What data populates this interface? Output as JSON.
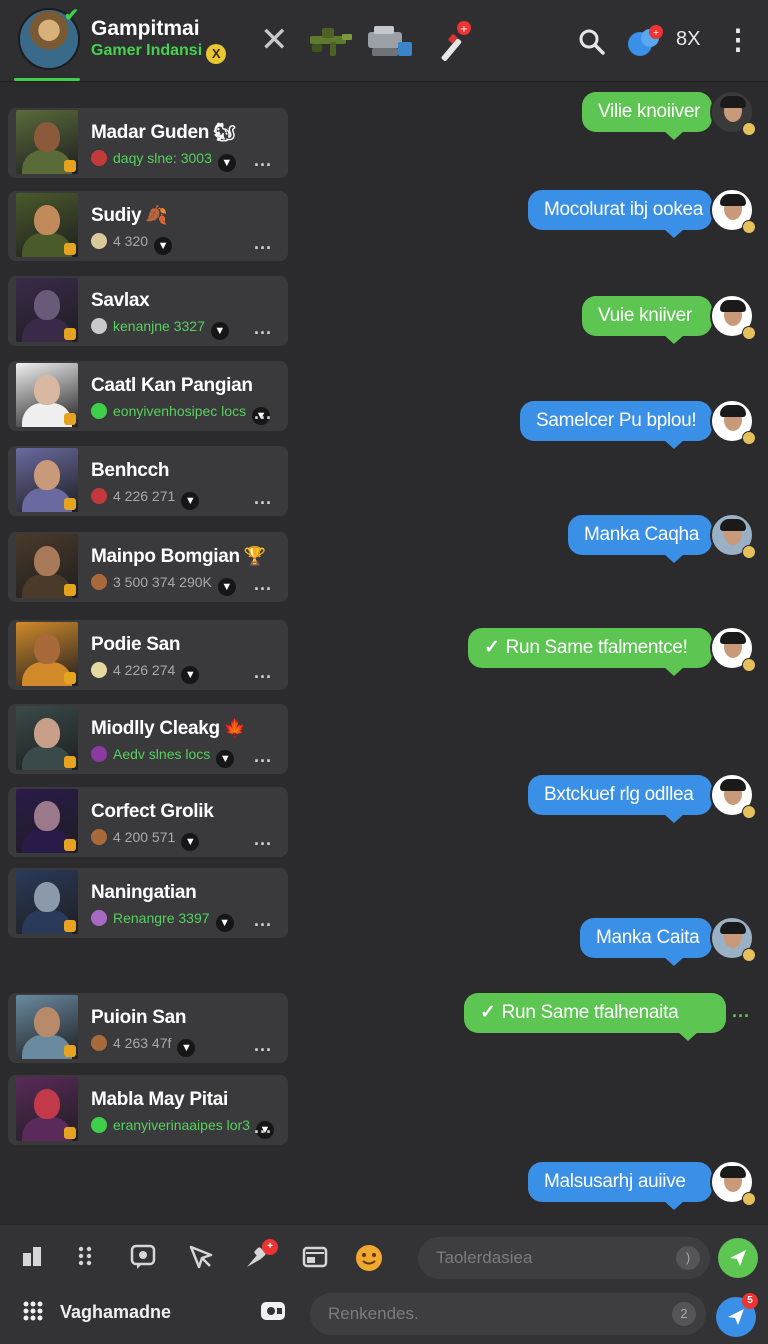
{
  "header": {
    "title": "Gampitmai",
    "subtitle": "Gamer Indansi",
    "subtitle_badge": "X",
    "close_symbol": "✕",
    "count_label": "8X",
    "accent": "#3ecf4a"
  },
  "contacts": [
    {
      "name": "Madar Guden",
      "stats": "daqy slne: 3003",
      "tag": "🐿",
      "stat_color": "green",
      "avatar_bg": "#5a6b3a",
      "face": "#8a5a3a"
    },
    {
      "name": "Sudiy",
      "stats": "4 320",
      "tag": "🍂",
      "stat_color": "gray",
      "avatar_bg": "#4a5a2a",
      "face": "#c28a5a"
    },
    {
      "name": "Savlax",
      "stats": "kenanjne 3327",
      "tag": "",
      "stat_color": "green",
      "avatar_bg": "#3a2a4a",
      "face": "#6a5a7a"
    },
    {
      "name": "Caatl Kan Pangian",
      "stats": "eonyivenhosipec locs",
      "tag": "",
      "stat_color": "green",
      "avatar_bg": "#f0f0f0",
      "face": "#d8b8a0"
    },
    {
      "name": "Benhcch",
      "stats": "4 226   271",
      "tag": "",
      "stat_color": "gray",
      "avatar_bg": "#6a6aa0",
      "face": "#c89a7a"
    },
    {
      "name": "Mainpo Bomgian",
      "stats": "3 500   374   290K",
      "tag": "🏆",
      "stat_color": "gray",
      "avatar_bg": "#4a3a2a",
      "face": "#a87a5a"
    },
    {
      "name": "Podie San",
      "stats": "4 226   274",
      "tag": "",
      "stat_color": "gray",
      "avatar_bg": "#d08a2a",
      "face": "#a86a3a"
    },
    {
      "name": "Miodlly Cleakg",
      "stats": "Aedv slnes locs",
      "tag": "🍁",
      "stat_color": "green",
      "avatar_bg": "#3a4a4a",
      "face": "#c8a08a"
    },
    {
      "name": "Corfect Grolik",
      "stats": "4 200   571",
      "tag": "",
      "stat_color": "gray",
      "avatar_bg": "#2a1a4a",
      "face": "#9a7a8a"
    },
    {
      "name": "Naningatian",
      "stats": "Renangre 3397",
      "tag": "",
      "stat_color": "green",
      "avatar_bg": "#2a3a5a",
      "face": "#8a9aaa"
    },
    {
      "name": "Puioin San",
      "stats": "4 263   47f",
      "tag": "",
      "stat_color": "gray",
      "avatar_bg": "#6a8aa0",
      "face": "#b88a6a"
    },
    {
      "name": "Mabla May Pitai",
      "stats": "eranyiverinaaipes lor3",
      "tag": "",
      "stat_color": "green",
      "avatar_bg": "#5a2a5a",
      "face": "#c23a4a"
    }
  ],
  "messages": [
    {
      "text": "Vilie knoiiver",
      "color": "green",
      "check": false
    },
    {
      "text": "Mocolurat ibj ookea",
      "color": "blue",
      "check": false
    },
    {
      "text": "Vuie kniiver",
      "color": "green",
      "check": false
    },
    {
      "text": "Samelcer Pu bplou!",
      "color": "blue",
      "check": false
    },
    {
      "text": "Manka Caqha",
      "color": "blue",
      "check": false
    },
    {
      "text": "Run Same  tfalmentce!",
      "color": "green",
      "check": true
    },
    {
      "text": "Bxtckuef rlg odllea",
      "color": "blue",
      "check": false
    },
    {
      "text": "Manka Caita",
      "color": "blue",
      "check": false
    },
    {
      "text": "Run Same  tfalhenaita",
      "color": "green",
      "check": true
    },
    {
      "text": "Malsusarhj auiive",
      "color": "blue",
      "check": false
    }
  ],
  "toolbar": {
    "input_placeholder": "Taolerdasiea",
    "input_end": ")",
    "menu_label": "Vaghamadne",
    "bottom_placeholder": "Renkendes.",
    "bottom_end": "2",
    "send_badge": "5",
    "accent_green": "#5dc552",
    "accent_blue": "#3a8fe6"
  }
}
